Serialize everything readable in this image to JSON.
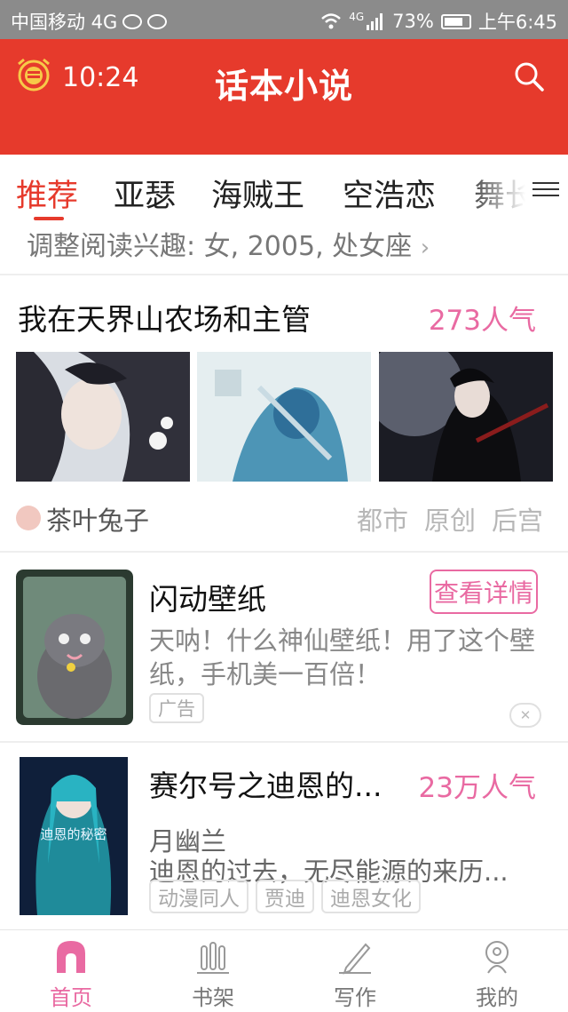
{
  "status_bar": {
    "carrier": "中国移动 4G",
    "network": "4G",
    "battery": "73%",
    "time": "上午6:45"
  },
  "app_bar": {
    "timer": "10:24",
    "title": "话本小说"
  },
  "tabs": [
    {
      "label": "推荐",
      "active": true
    },
    {
      "label": "亚瑟"
    },
    {
      "label": "海贼王"
    },
    {
      "label": "空浩恋"
    },
    {
      "label": "舞长"
    }
  ],
  "interest_link": "调整阅读兴趣: 女, 2005, 处女座",
  "featured": {
    "title": "我在天界山农场和主管",
    "popularity": "273人气",
    "author": "茶叶兔子",
    "tags": [
      "都市",
      "原创",
      "后宫"
    ]
  },
  "ad": {
    "title": "闪动壁纸",
    "button": "查看详情",
    "desc": "天呐！什么神仙壁纸！用了这个壁纸，手机美一百倍！",
    "badge": "广告"
  },
  "book": {
    "title": "赛尔号之迪恩的...",
    "popularity": "23万人气",
    "author": "月幽兰",
    "desc": "迪恩的过去，无尽能源的来历...",
    "cover_text": "迪恩的秘密",
    "tags": [
      "动漫同人",
      "贾迪",
      "迪恩女化"
    ]
  },
  "bottom_nav": [
    {
      "label": "首页",
      "active": true,
      "icon": "home-icon"
    },
    {
      "label": "书架",
      "icon": "bookshelf-icon"
    },
    {
      "label": "写作",
      "icon": "pen-icon"
    },
    {
      "label": "我的",
      "icon": "profile-icon"
    }
  ],
  "colors": {
    "primary": "#e63a2c",
    "pink": "#e96aa2"
  }
}
